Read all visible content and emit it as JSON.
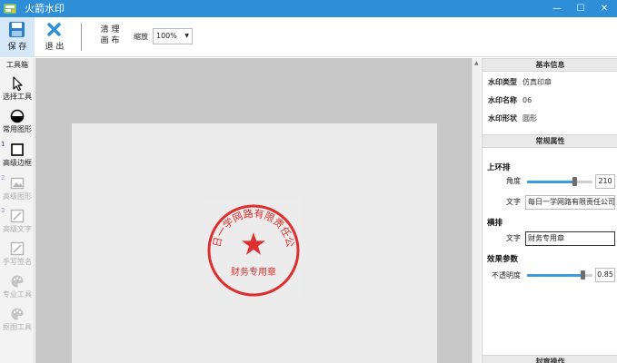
{
  "window": {
    "title": "火箭水印",
    "minimize_glyph": "—",
    "maximize_glyph": "☐",
    "close_glyph": "✕"
  },
  "toolbar": {
    "save_label": "保 存",
    "exit_label": "退 出",
    "clear_line1": "清 理",
    "clear_line2": "画 布",
    "zoom_label": "缩放",
    "zoom_value": "100%",
    "zoom_caret": "▼"
  },
  "toolbox": {
    "title": "工具箱",
    "tools": [
      {
        "label": "选择工具",
        "icon": "cursor-icon",
        "enabled": true,
        "number": ""
      },
      {
        "label": "常用图形",
        "icon": "circle-shape-icon",
        "enabled": true,
        "number": ""
      },
      {
        "label": "高级边框",
        "icon": "square-border-icon",
        "enabled": true,
        "number": "1"
      },
      {
        "label": "高级图形",
        "icon": "image-icon",
        "enabled": false,
        "number": "2"
      },
      {
        "label": "高级文字",
        "icon": "edit-icon",
        "enabled": false,
        "number": "3"
      },
      {
        "label": "手写签名",
        "icon": "pen-icon",
        "enabled": false,
        "number": ""
      },
      {
        "label": "专业工具",
        "icon": "palette-icon",
        "enabled": false,
        "number": ""
      },
      {
        "label": "抠图工具",
        "icon": "palette-icon",
        "enabled": false,
        "number": ""
      }
    ]
  },
  "stamp": {
    "top_text": "每日一学网路有限责任公司",
    "bottom_text": "财务专用章",
    "color": "#dd2f2f"
  },
  "panel": {
    "basic_info_header": "基本信息",
    "basic_info": [
      {
        "key": "水印类型",
        "value": "仿真印章"
      },
      {
        "key": "水印名称",
        "value": "06"
      },
      {
        "key": "水印形状",
        "value": "圆形"
      }
    ],
    "props_header": "常规属性",
    "ring_group": "上环排",
    "angle_label": "角度",
    "angle_value": "210",
    "angle_fraction": 0.72,
    "ring_text_label": "文字",
    "ring_text_value": "每日一学网路有限责任公司",
    "horizontal_group": "横排",
    "horizontal_text_label": "文字",
    "horizontal_text_value": "财务专用章",
    "effect_group": "效果参数",
    "opacity_label": "不透明度",
    "opacity_value": "0.85",
    "opacity_fraction": 0.85,
    "bottom_header": "封章操作"
  },
  "colors": {
    "titlebar": "#2e8fd8",
    "accent": "#3a9be0"
  }
}
